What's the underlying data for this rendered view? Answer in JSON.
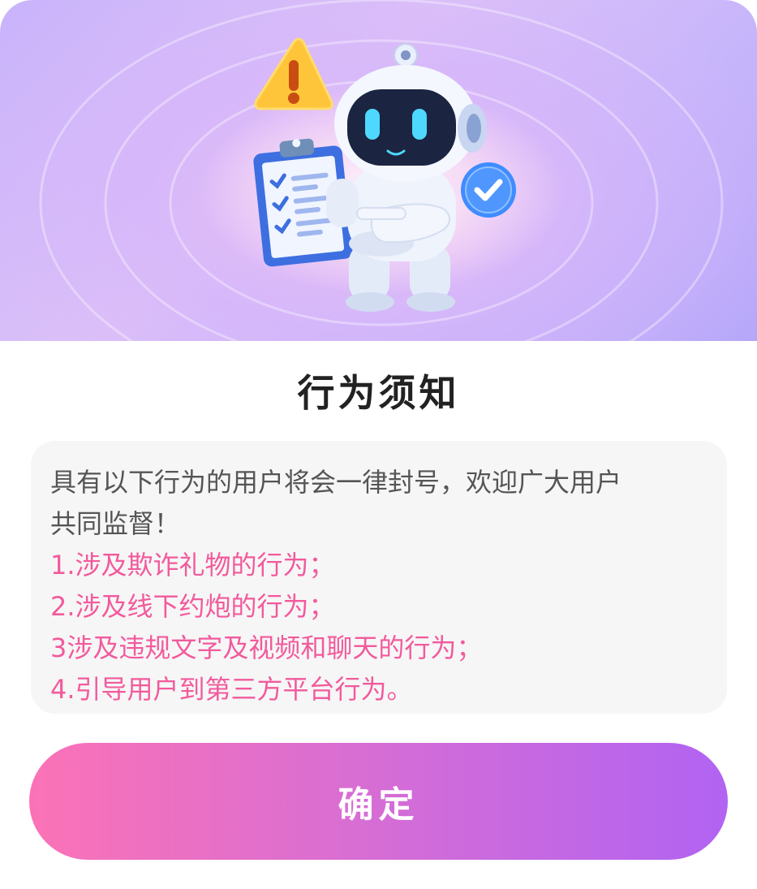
{
  "dialog": {
    "title": "行为须知",
    "intro_line1": "具有以下行为的用户将会一律封号，欢迎广大用户",
    "intro_line2": "共同监督！",
    "rules": [
      "1.涉及欺诈礼物的行为；",
      "2.涉及线下约炮的行为；",
      "3涉及违规文字及视频和聊天的行为；",
      "4.引导用户到第三方平台行为。"
    ],
    "confirm_label": "确定"
  },
  "illustration": {
    "icons": [
      "warning-icon",
      "clipboard-checklist-icon",
      "robot-mascot",
      "check-badge-icon"
    ]
  },
  "colors": {
    "rule_text": "#f25a9c",
    "button_gradient_start": "#fb72b6",
    "button_gradient_end": "#b163f2",
    "notice_bg": "#f6f6f6"
  }
}
